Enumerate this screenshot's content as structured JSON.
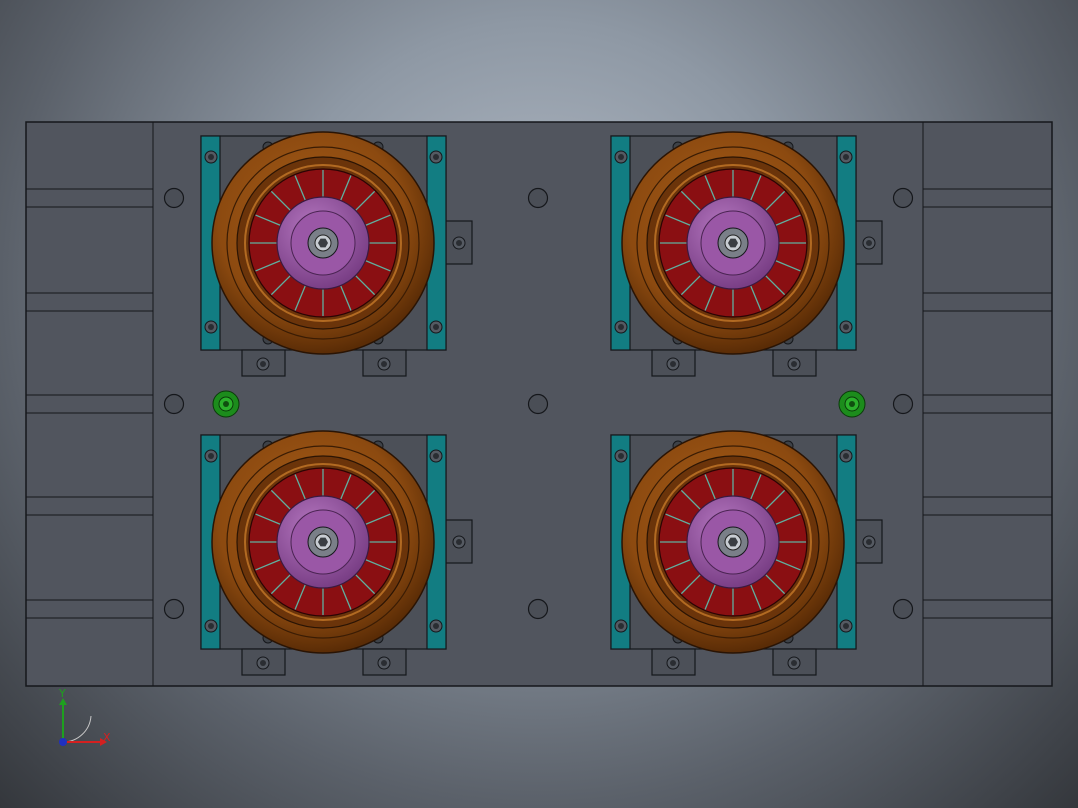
{
  "triad": {
    "x_label": "X",
    "y_label": "Y",
    "x_color": "#d42020",
    "y_color": "#1ea01e",
    "z_color": "#2030c0"
  },
  "colors": {
    "plate": "#51555e",
    "edge": "#15171b",
    "bracket": "#127d82",
    "wheel_outer": "#8c4a10",
    "wheel_ring": "#6b340a",
    "spoke_area": "#8a0f12",
    "hub": "#9a57a6",
    "hub_dark": "#6e3a7a",
    "accent_green": "#1c8c1c"
  },
  "icons": [
    "axis-triad-icon",
    "wheel-assembly-icon",
    "bolt-hole-icon"
  ]
}
